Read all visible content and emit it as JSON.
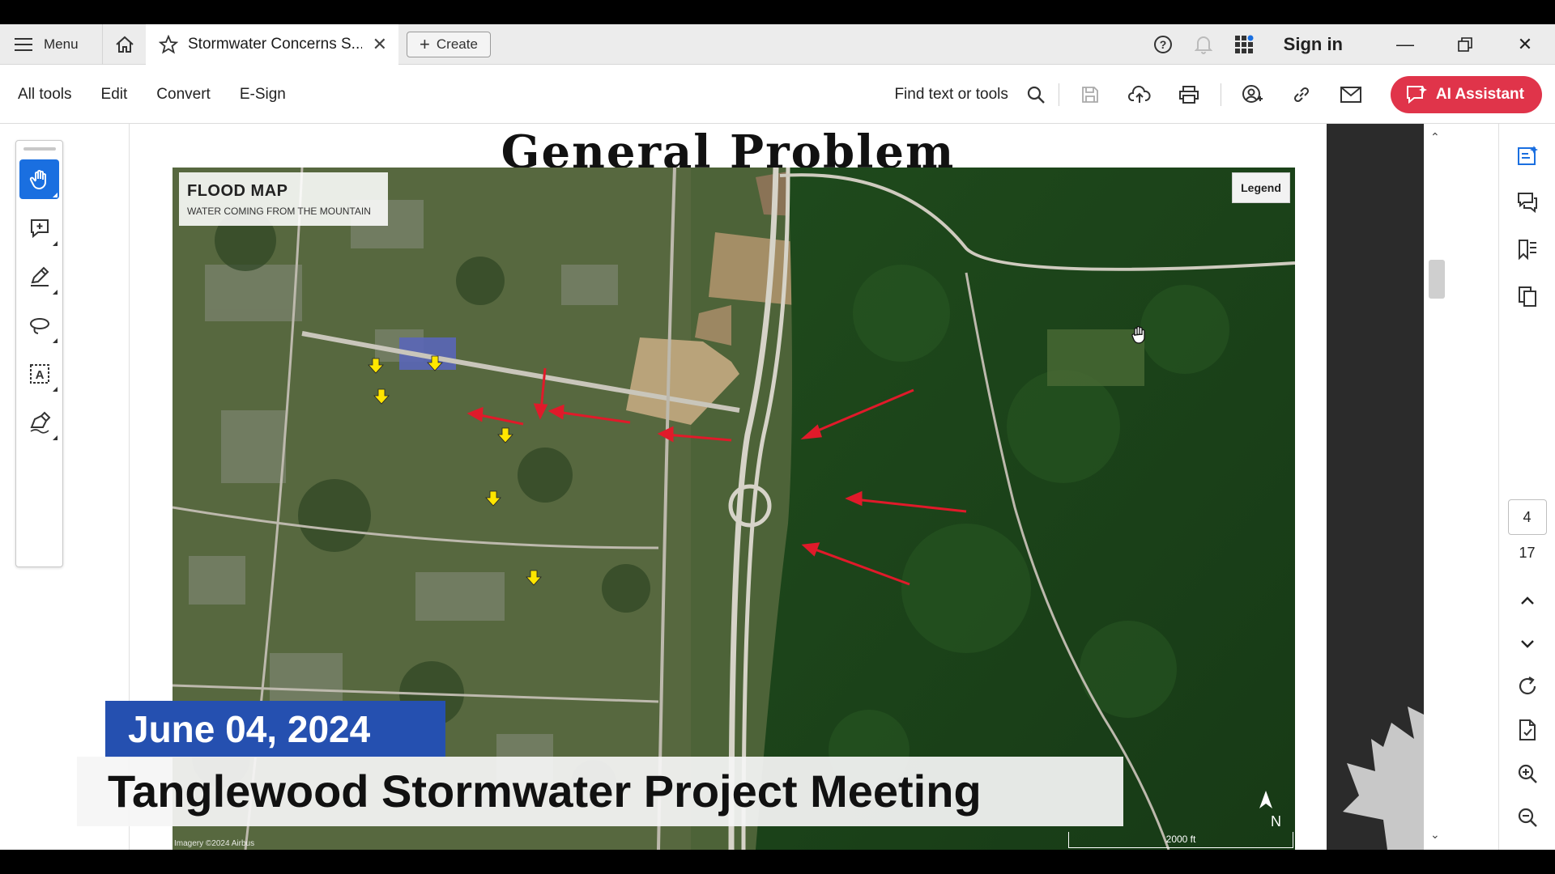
{
  "tabbar": {
    "menu_label": "Menu",
    "tab_title": "Stormwater Concerns S...",
    "create_label": "Create",
    "sign_in_label": "Sign in"
  },
  "toolbar": {
    "menus": [
      "All tools",
      "Edit",
      "Convert",
      "E-Sign"
    ],
    "find_label": "Find text or tools",
    "ai_assistant_label": "AI Assistant"
  },
  "page_nav": {
    "current_page": "4",
    "total_pages": "17"
  },
  "slide": {
    "title": "General Problem",
    "flood_map_title": "FLOOD MAP",
    "flood_map_subtitle": "WATER COMING FROM THE MOUNTAIN",
    "legend_label": "Legend",
    "scale_label": "2000 ft",
    "attribution": "Imagery ©2024 Airbus"
  },
  "banner": {
    "date": "June 04, 2024",
    "title": "Tanglewood Stormwater Project Meeting"
  },
  "colors": {
    "accent_blue": "#1a6fe0",
    "ai_button": "#e0344a",
    "banner_blue": "#2550b0",
    "arrow_red": "#e01a2a",
    "arrow_yellow": "#ffe600"
  }
}
